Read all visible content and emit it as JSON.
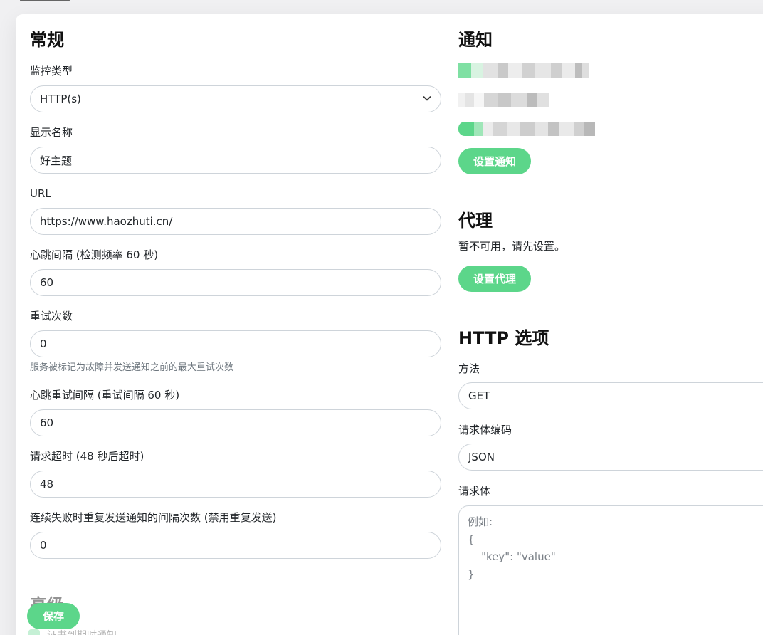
{
  "general": {
    "title": "常规",
    "monitor_type": {
      "label": "监控类型",
      "value": "HTTP(s)"
    },
    "display_name": {
      "label": "显示名称",
      "value": "好主题"
    },
    "url": {
      "label": "URL",
      "value": "https://www.haozhuti.cn/"
    },
    "heartbeat_interval": {
      "label": "心跳间隔 (检测频率 60 秒)",
      "value": "60"
    },
    "retries": {
      "label": "重试次数",
      "value": "0",
      "hint": "服务被标记为故障并发送通知之前的最大重试次数"
    },
    "retry_interval": {
      "label": "心跳重试间隔 (重试间隔 60 秒)",
      "value": "60"
    },
    "timeout": {
      "label": "请求超时 (48 秒后超时)",
      "value": "48"
    },
    "resend_interval": {
      "label": "连续失败时重复发送通知的间隔次数 (禁用重复发送)",
      "value": "0"
    }
  },
  "advanced": {
    "title": "高级",
    "first_option": "证书到期时通知"
  },
  "notifications": {
    "title": "通知",
    "setup_button": "设置通知"
  },
  "proxy": {
    "title": "代理",
    "unavailable_text": "暂不可用，请先设置。",
    "setup_button": "设置代理"
  },
  "http_options": {
    "title": "HTTP 选项",
    "method": {
      "label": "方法",
      "value": "GET"
    },
    "body_encoding": {
      "label": "请求体编码",
      "value": "JSON"
    },
    "body": {
      "label": "请求体",
      "placeholder": "例如:\n{\n    \"key\": \"value\"\n}"
    }
  },
  "footer": {
    "save_button": "保存"
  },
  "colors": {
    "accent": "#5cd68a",
    "border": "#ced4da",
    "background": "#f0f0f2"
  }
}
